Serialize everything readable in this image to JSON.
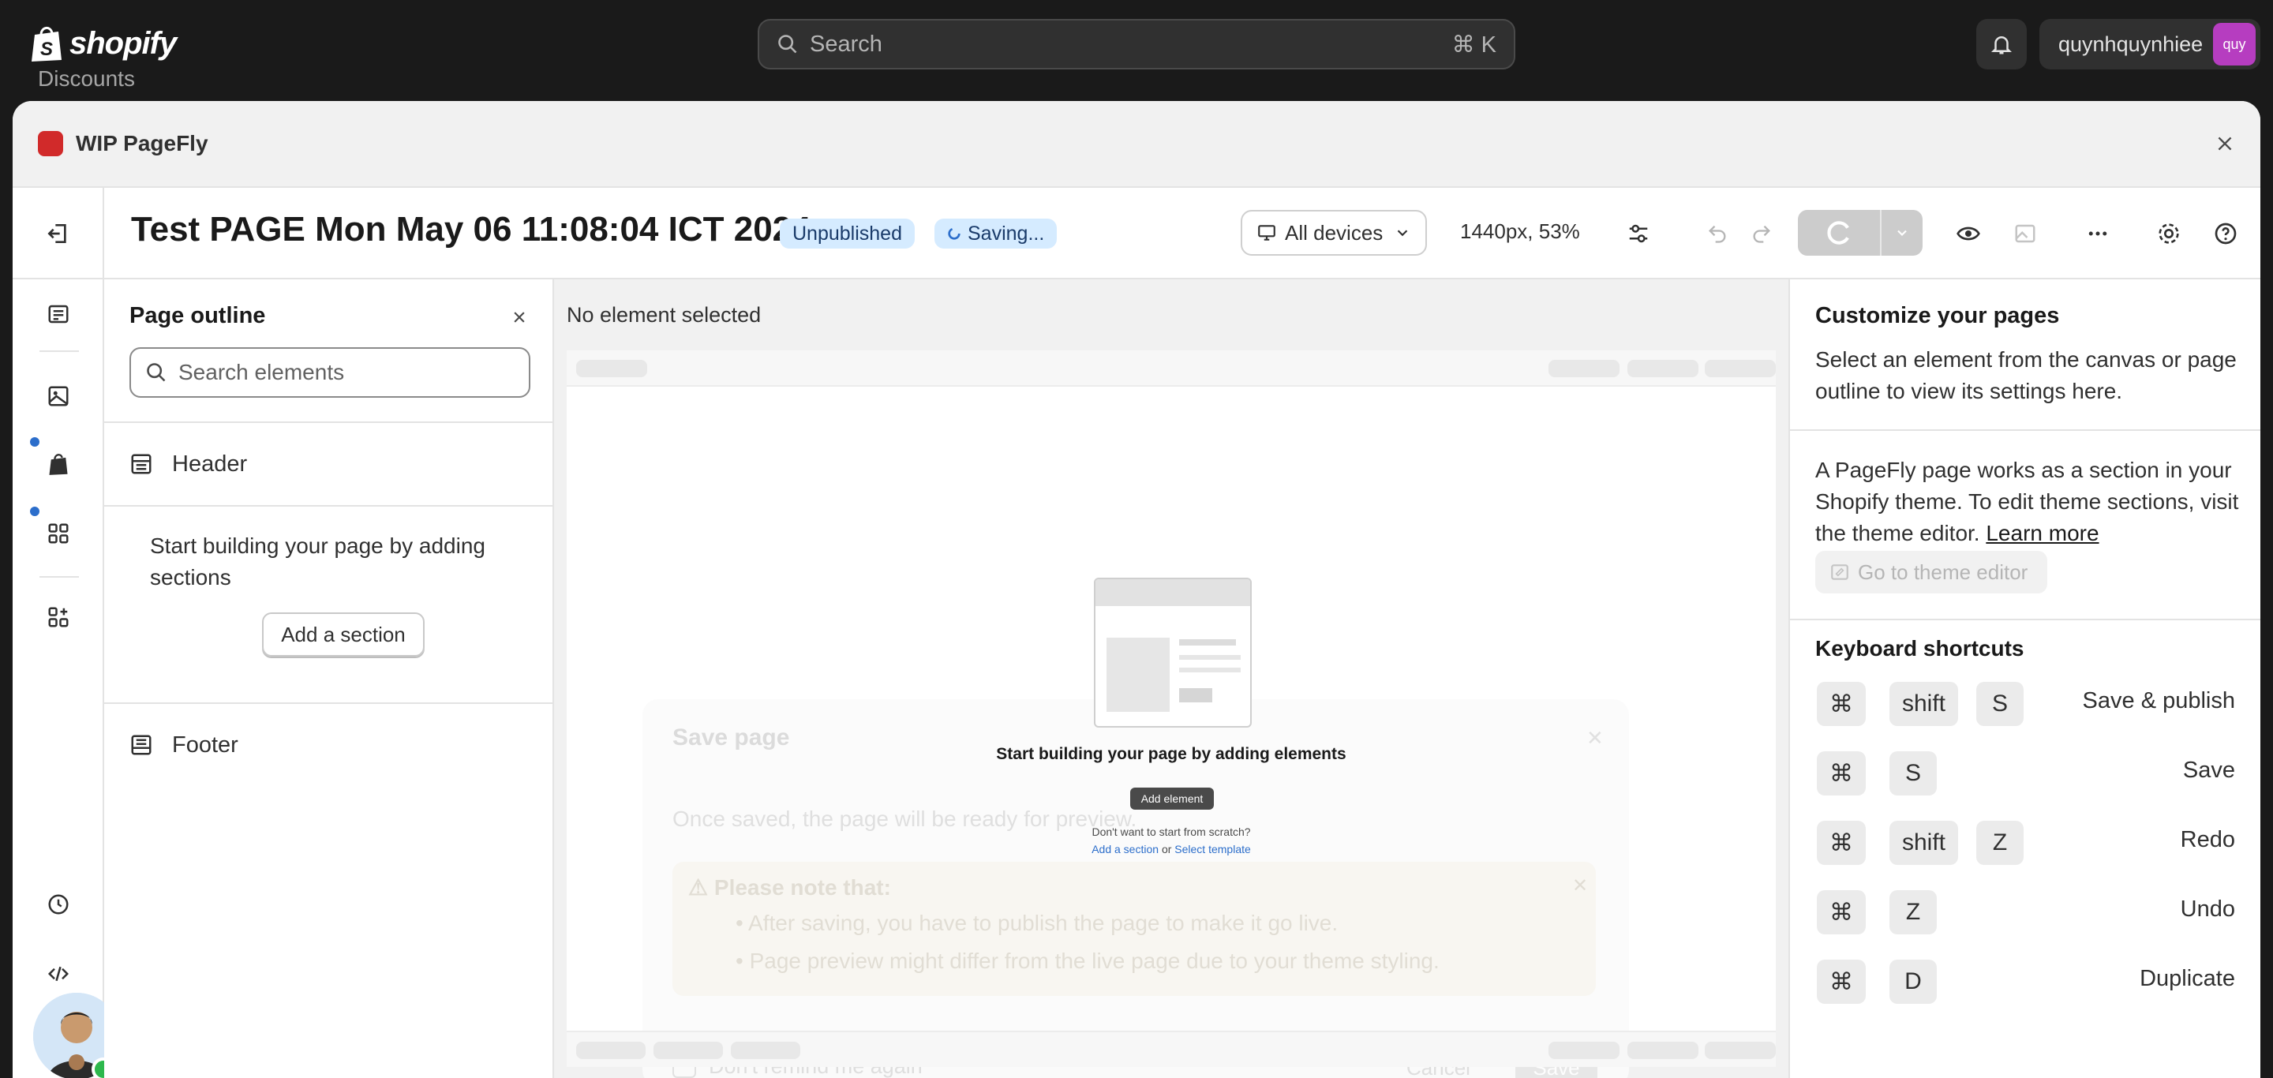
{
  "topbar": {
    "logo_text": "shopify",
    "search_placeholder": "Search",
    "search_shortcut": "⌘ K",
    "user_name": "quynhquynhiee",
    "user_initials": "quy"
  },
  "background_peek": "Discounts",
  "modal": {
    "app_title": "WIP PageFly"
  },
  "toolbar": {
    "page_title": "Test PAGE Mon May 06 11:08:04 ICT 2024",
    "status_unpublished": "Unpublished",
    "status_saving": "Saving...",
    "device_select": "All devices",
    "zoom_readout": "1440px, 53%"
  },
  "outline": {
    "title": "Page outline",
    "search_placeholder": "Search elements",
    "header_label": "Header",
    "empty_text": "Start building your page by adding sections",
    "add_section_button": "Add a section",
    "footer_label": "Footer"
  },
  "canvas": {
    "selection_status": "No element selected",
    "empty_title": "Start building your page by adding elements",
    "add_element_button": "Add element",
    "scratch_text": "Don't want to start from scratch?",
    "add_section_link": "Add a section",
    "or_text": "or",
    "select_template_link": "Select template"
  },
  "ghost_dialog": {
    "title": "Save page",
    "body": "Once saved, the page will be ready for preview.",
    "note_title": "Please note that:",
    "note_items": [
      "After saving, you have to publish the page to make it go live.",
      "Page preview might differ from the live page due to your theme styling."
    ],
    "checkbox_label": "Don't remind me again",
    "cancel": "Cancel",
    "save": "Save"
  },
  "rightpanel": {
    "title": "Customize your pages",
    "select_text": "Select an element from the canvas or page outline to view its settings here.",
    "info_text": "A PageFly page works as a section in your Shopify theme. To edit theme sections, visit the theme editor.",
    "learn_more": "Learn more",
    "theme_editor_button": "Go to theme editor",
    "shortcuts_title": "Keyboard shortcuts",
    "shortcuts": [
      {
        "keys": [
          "⌘",
          "shift",
          "S"
        ],
        "label": "Save & publish"
      },
      {
        "keys": [
          "⌘",
          "S"
        ],
        "label": "Save"
      },
      {
        "keys": [
          "⌘",
          "shift",
          "Z"
        ],
        "label": "Redo"
      },
      {
        "keys": [
          "⌘",
          "Z"
        ],
        "label": "Undo"
      },
      {
        "keys": [
          "⌘",
          "D"
        ],
        "label": "Duplicate"
      }
    ]
  },
  "colors": {
    "topbar": "#1a1a1a",
    "accent_blue": "#2c6ecb",
    "badge_bg": "#d5ebff",
    "avatar_bg": "#b63dc0",
    "online": "#2db84d",
    "app_icon": "#d12a2a"
  }
}
